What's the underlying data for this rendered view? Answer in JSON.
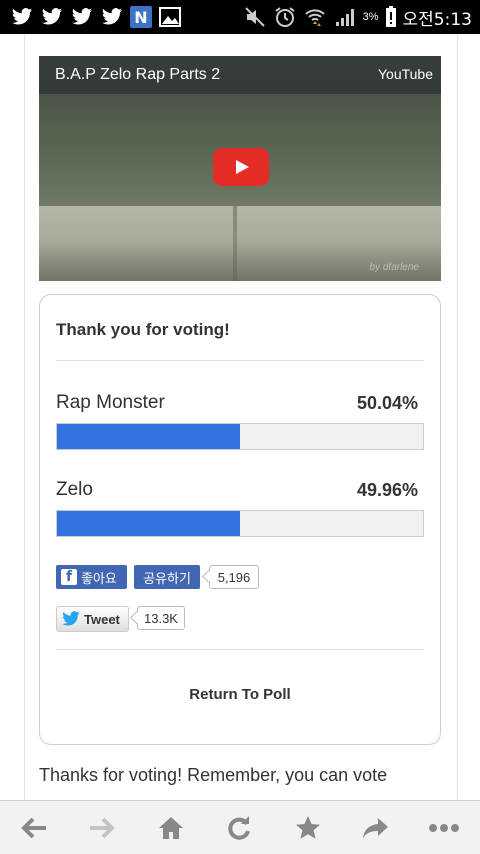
{
  "status_bar": {
    "icons_left": [
      "twitter-icon",
      "twitter-icon",
      "twitter-icon",
      "twitter-icon",
      "n-app-icon",
      "gallery-icon"
    ],
    "n_badge": "N",
    "icons_right": [
      "mute-icon",
      "alarm-icon",
      "wifi-icon",
      "signal-icon",
      "battery-icon"
    ],
    "battery": "3%",
    "time": "오전5:13"
  },
  "video": {
    "title": "B.A.P Zelo Rap Parts 2",
    "source": "YouTube",
    "watermark": "by dfarlene"
  },
  "poll": {
    "heading": "Thank you for voting!",
    "options": [
      {
        "name": "Rap Monster",
        "percent": "50.04%",
        "fill": 0.5004
      },
      {
        "name": "Zelo",
        "percent": "49.96%",
        "fill": 0.4996
      }
    ],
    "facebook": {
      "like_label": "좋아요",
      "share_label": "공유하기",
      "count": "5,196"
    },
    "twitter": {
      "tweet_label": "Tweet",
      "count": "13.3K"
    },
    "return_label": "Return To Poll"
  },
  "page_text": "Thanks for voting! Remember, you can vote",
  "toolbar": {
    "buttons": [
      "back-icon",
      "forward-icon",
      "home-icon",
      "refresh-icon",
      "bookmark-star-icon",
      "share-icon",
      "more-icon"
    ]
  },
  "colors": {
    "bar_fill": "#3374e0",
    "facebook": "#4267b2",
    "youtube_red": "#e52d27"
  }
}
